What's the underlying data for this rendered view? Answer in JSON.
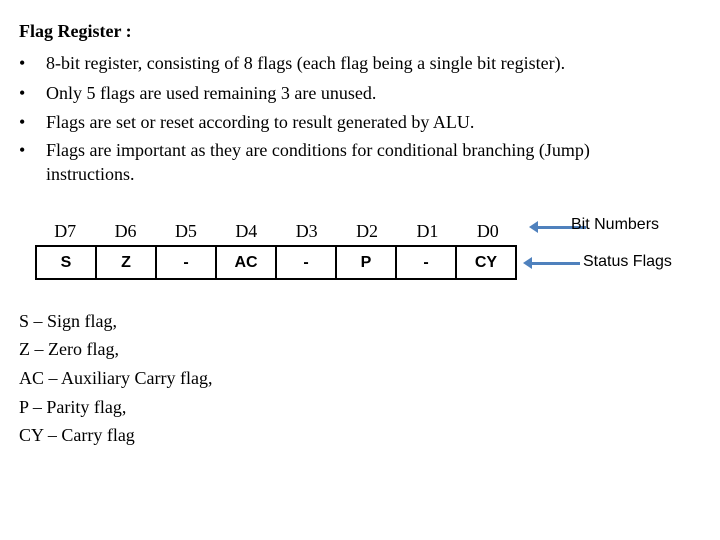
{
  "title": "Flag Register :",
  "bullet_symbol": "•",
  "bullets": [
    "8-bit register, consisting of 8 flags (each flag being a single bit register).",
    "Only 5 flags are used remaining 3 are unused.",
    "Flags are set or reset according to result generated by ALU.",
    "Flags are important as they are conditions for conditional branching (Jump)"
  ],
  "bullet_continuation": "instructions.",
  "register": {
    "bit_numbers": [
      "D7",
      "D6",
      "D5",
      "D4",
      "D3",
      "D2",
      "D1",
      "D0"
    ],
    "status_flags": [
      "S",
      "Z",
      "-",
      "AC",
      "-",
      "P",
      "-",
      "CY"
    ]
  },
  "annotations": {
    "bit_numbers_label": "Bit Numbers",
    "status_flags_label": "Status Flags",
    "arrow_color": "#4f81bd"
  },
  "legend": [
    "S – Sign flag,",
    "Z – Zero flag,",
    "AC – Auxiliary Carry flag,",
    "P – Parity flag,",
    "CY – Carry flag"
  ]
}
